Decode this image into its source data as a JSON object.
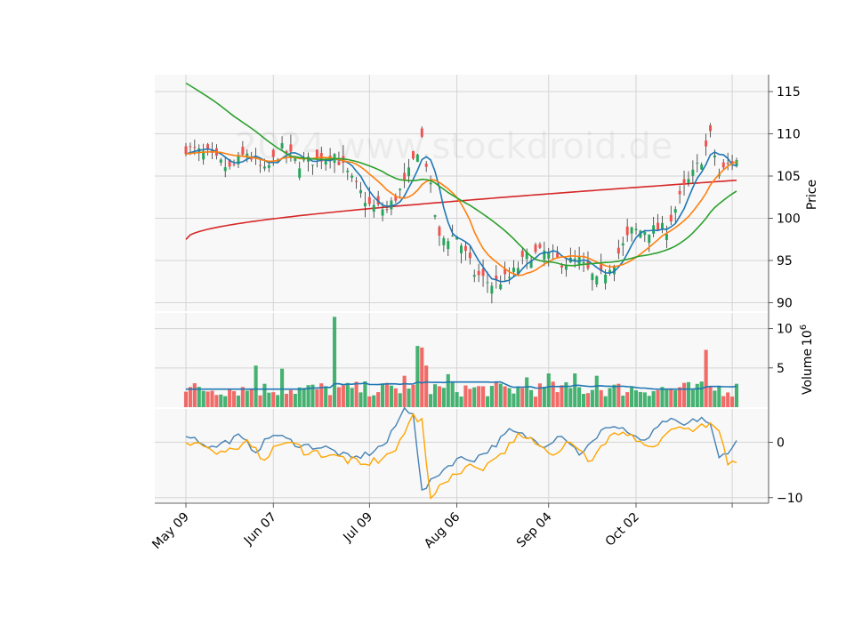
{
  "chart_data": {
    "type": "candlestick",
    "watermark": "2024 www.stockdroid.de",
    "x_tick_labels": [
      "May 09",
      "Jun 07",
      "Jul 09",
      "Aug 06",
      "Sep 04",
      "Oct 02"
    ],
    "x_tick_dates": [
      "2024-05-09",
      "2024-06-07",
      "2024-07-09",
      "2024-08-06",
      "2024-09-04",
      "2024-10-02"
    ],
    "price_panel": {
      "ylabel": "Price",
      "ylim": [
        89,
        117
      ],
      "yticks": [
        90,
        95,
        100,
        105,
        110,
        115
      ],
      "series_colors": {
        "ma_fast": "#1f77b4",
        "ma_mid": "#ff7f0e",
        "ma_slow": "#2ca02c",
        "ma_long": "#d62728"
      },
      "up_color": "#26a65b",
      "down_color": "#f0524f"
    },
    "volume_panel": {
      "ylabel": "Volume",
      "exponent_label": "6",
      "ylim": [
        0,
        12
      ],
      "yticks": [
        5,
        10
      ],
      "ma_color": "#1f77b4"
    },
    "oscillator_panel": {
      "ylim": [
        -11,
        6
      ],
      "yticks": [
        0,
        -10
      ],
      "line1_color": "#4682b4",
      "line2_color": "#ffa500"
    },
    "close_anchors": [
      [
        0,
        108.3
      ],
      [
        5,
        107.5
      ],
      [
        10,
        105.8
      ],
      [
        14,
        107.8
      ],
      [
        18,
        105.5
      ],
      [
        22,
        108.2
      ],
      [
        26,
        106.5
      ],
      [
        30,
        107.0
      ],
      [
        34,
        107.6
      ],
      [
        38,
        104.5
      ],
      [
        42,
        101.5
      ],
      [
        46,
        101.0
      ],
      [
        50,
        104.0
      ],
      [
        54,
        109.5
      ],
      [
        58,
        97.5
      ],
      [
        62,
        98.0
      ],
      [
        66,
        93.5
      ],
      [
        70,
        92.2
      ],
      [
        74,
        93.0
      ],
      [
        78,
        95.5
      ],
      [
        82,
        96.0
      ],
      [
        86,
        94.8
      ],
      [
        90,
        95.0
      ],
      [
        94,
        92.5
      ],
      [
        98,
        95.0
      ],
      [
        102,
        98.5
      ],
      [
        106,
        98.6
      ],
      [
        110,
        98.8
      ],
      [
        114,
        103.5
      ],
      [
        118,
        107.0
      ],
      [
        120,
        109.8
      ],
      [
        122,
        105.2
      ],
      [
        125,
        106.8
      ]
    ],
    "volume_spikes": [
      [
        34,
        11.5
      ],
      [
        53,
        7.8
      ],
      [
        54,
        7.6
      ],
      [
        55,
        5.3
      ],
      [
        60,
        4.2
      ],
      [
        78,
        3.8
      ],
      [
        83,
        4.3
      ],
      [
        89,
        4.3
      ],
      [
        94,
        4.0
      ],
      [
        119,
        7.3
      ],
      [
        16,
        5.3
      ],
      [
        22,
        4.9
      ],
      [
        50,
        4.0
      ]
    ],
    "osc_anchors": [
      [
        0,
        1.5
      ],
      [
        6,
        -1.0
      ],
      [
        12,
        1.0
      ],
      [
        16,
        -1.5
      ],
      [
        20,
        1.5
      ],
      [
        26,
        -0.5
      ],
      [
        32,
        -1.0
      ],
      [
        38,
        -3.0
      ],
      [
        42,
        -2.0
      ],
      [
        46,
        0.0
      ],
      [
        50,
        6.0
      ],
      [
        52,
        5.5
      ],
      [
        54,
        -9.0
      ],
      [
        58,
        -5.5
      ],
      [
        62,
        -3.0
      ],
      [
        66,
        -3.0
      ],
      [
        70,
        -1.0
      ],
      [
        74,
        2.0
      ],
      [
        78,
        1.0
      ],
      [
        82,
        -0.5
      ],
      [
        86,
        1.5
      ],
      [
        90,
        -2.0
      ],
      [
        94,
        0.5
      ],
      [
        96,
        3.0
      ],
      [
        100,
        2.5
      ],
      [
        104,
        0.0
      ],
      [
        106,
        1.0
      ],
      [
        110,
        4.0
      ],
      [
        114,
        3.0
      ],
      [
        118,
        4.5
      ],
      [
        120,
        3.0
      ],
      [
        122,
        -3.0
      ],
      [
        126,
        0.0
      ]
    ]
  }
}
